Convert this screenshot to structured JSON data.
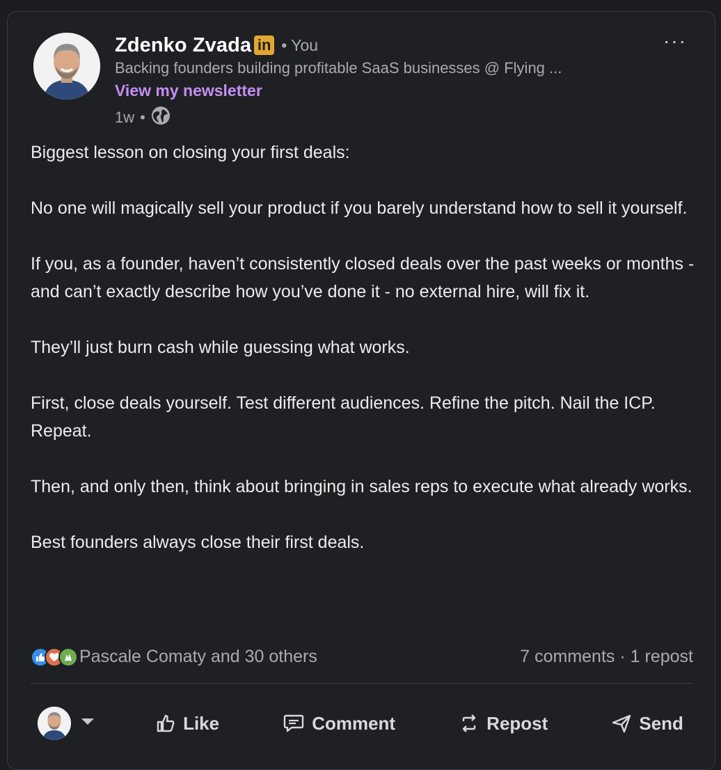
{
  "post": {
    "author": {
      "name": "Zdenko Zvada",
      "badge": "in",
      "relation": "• You",
      "headline": "Backing founders building profitable SaaS businesses @ Flying ...",
      "newsletter_link": "View my newsletter",
      "time": "1w",
      "time_sep": "•",
      "visibility_icon": "globe-icon"
    },
    "more_label": "···",
    "paragraphs": [
      "Biggest lesson on closing your first deals:",
      "No one will magically sell your product if you barely understand how to sell it yourself.",
      "If you, as a founder, haven’t consistently closed deals over the past weeks or months - and can’t exactly describe how you’ve done it - no external hire, will fix it.",
      "They’ll just burn cash while guessing what works.",
      "First, close deals yourself. Test different audiences. Refine the pitch. Nail the ICP. Repeat.",
      "Then, and only then, think about bringing in sales reps to execute what already works.",
      "Best founders always close their first deals."
    ],
    "social": {
      "reaction_icons": [
        "like-icon",
        "love-icon",
        "celebrate-icon"
      ],
      "reactions_text": "Pascale Comaty and 30 others",
      "comments_text": "7 comments",
      "sep": "·",
      "reposts_text": "1 repost"
    },
    "actions": {
      "like": "Like",
      "comment": "Comment",
      "repost": "Repost",
      "send": "Send"
    }
  },
  "colors": {
    "background": "#1e2024",
    "accent_newsletter": "#c28ff2",
    "linkedin_badge": "#e3a72f",
    "like": "#378fe9",
    "love": "#df704d",
    "celebrate": "#6dae4f"
  }
}
